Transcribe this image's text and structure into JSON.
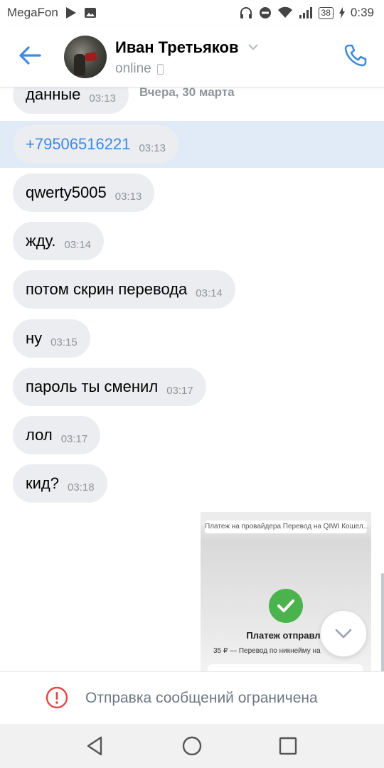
{
  "status_bar": {
    "carrier": "MegaFon",
    "battery": "38",
    "time": "0:39"
  },
  "header": {
    "contact_name": "Иван Третьяков",
    "presence": "online"
  },
  "messages": [
    {
      "text": "данные",
      "time": "03:13"
    },
    {
      "text": "+79506516221",
      "time": "03:13"
    },
    {
      "text": "qwerty5005",
      "time": "03:13"
    },
    {
      "text": "жду.",
      "time": "03:14"
    },
    {
      "text": "потом скрин перевода",
      "time": "03:14"
    },
    {
      "text": "ну",
      "time": "03:15"
    },
    {
      "text": "пароль ты сменил",
      "time": "03:17"
    },
    {
      "text": "лол",
      "time": "03:17"
    },
    {
      "text": "кид?",
      "time": "03:18"
    }
  ],
  "date_separator": "Вчера, 30 марта",
  "attachment": {
    "top_card": "Платеж на провайдера Перевод на QIWI Кошел...",
    "title": "Платеж отправле",
    "subtitle": "35 ₽ — Перевод по никнейму на"
  },
  "restriction": {
    "text": "Отправка сообщений ограничена"
  },
  "colors": {
    "accent": "#3f8ae0",
    "bubble": "#ebedf0",
    "selected_row": "#e0ebf7",
    "success": "#4bb34b",
    "warning": "#e64646"
  }
}
